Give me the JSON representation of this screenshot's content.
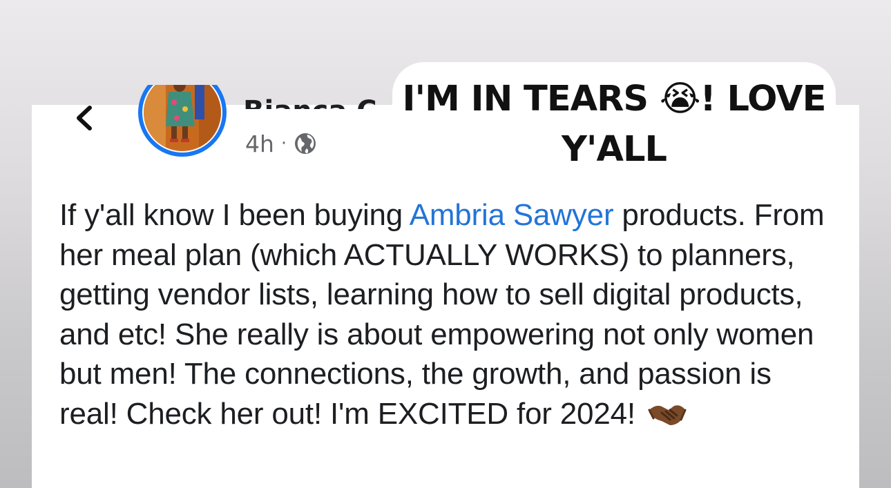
{
  "header": {
    "author_name": "Bianca C",
    "timestamp": "4h",
    "separator": "·",
    "audience_icon": "globe-icon",
    "back_icon": "chevron-left-icon"
  },
  "caption": {
    "text": "I'M IN TEARS 😭! LOVE Y'ALL"
  },
  "post": {
    "text_before_mention": "If y'all know I been buying ",
    "mention": "Ambria Sawyer",
    "text_after_mention": " products. From her meal plan (which ACTUALLY WORKS) to planners, getting vendor lists, learning how to sell digital products, and etc! She really is about empowering not only women but men! The connections, the growth, and passion is real! Check her out! I'm EXCITED for 2024!",
    "trailing_emoji": "🤝🏾"
  },
  "colors": {
    "link": "#2374d8",
    "avatar_ring": "#1877f2",
    "text": "#1c1e21",
    "meta": "#65676b"
  }
}
